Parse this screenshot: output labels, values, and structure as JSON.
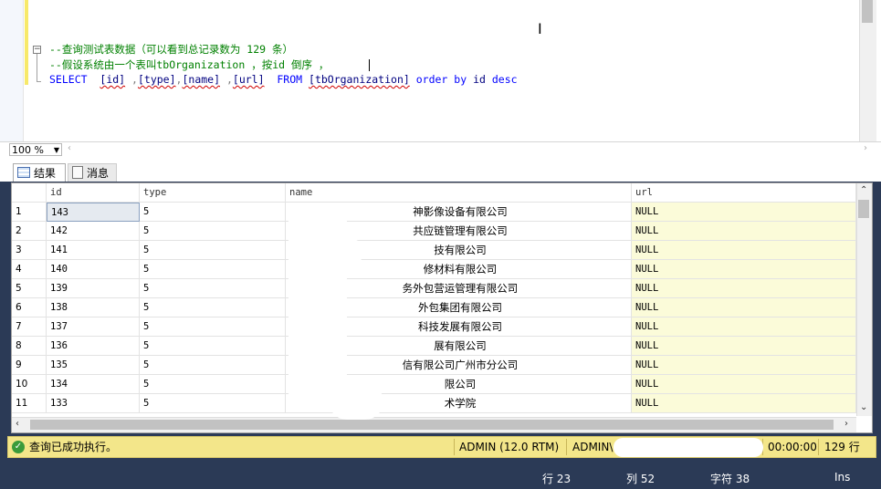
{
  "editor": {
    "line1_comment": "--查询测试表数据（可以看到总记录数为 129 条）",
    "line2_comment": "--假设系统由一个表叫tbOrganization ，按id 倒序 ， ",
    "sql": {
      "select": "SELECT",
      "col_id": "[id]",
      "col_type": "[type]",
      "col_name": "[name]",
      "col_url": "[url]",
      "from": "FROM",
      "table": "[tbOrganization]",
      "order_by": "order by",
      "order_col": "id",
      "desc": "desc"
    }
  },
  "zoom": {
    "value": "100 %"
  },
  "tabs": {
    "results": "结果",
    "messages": "消息"
  },
  "grid": {
    "columns": [
      "id",
      "type",
      "name",
      "url"
    ],
    "rows": [
      {
        "n": "1",
        "id": "143",
        "type": "5",
        "name": "神影像设备有限公司",
        "url": "NULL"
      },
      {
        "n": "2",
        "id": "142",
        "type": "5",
        "name": "共应链管理有限公司",
        "url": "NULL"
      },
      {
        "n": "3",
        "id": "141",
        "type": "5",
        "name": "技有限公司",
        "url": "NULL"
      },
      {
        "n": "4",
        "id": "140",
        "type": "5",
        "name": "修材料有限公司",
        "url": "NULL"
      },
      {
        "n": "5",
        "id": "139",
        "type": "5",
        "name": "务外包营运管理有限公司",
        "url": "NULL"
      },
      {
        "n": "6",
        "id": "138",
        "type": "5",
        "name": "外包集团有限公司",
        "url": "NULL"
      },
      {
        "n": "7",
        "id": "137",
        "type": "5",
        "name": "科技发展有限公司",
        "url": "NULL"
      },
      {
        "n": "8",
        "id": "136",
        "type": "5",
        "name": "展有限公司",
        "url": "NULL"
      },
      {
        "n": "9",
        "id": "135",
        "type": "5",
        "name": "信有限公司广州市分公司",
        "url": "NULL"
      },
      {
        "n": "10",
        "id": "134",
        "type": "5",
        "name": "限公司",
        "url": "NULL"
      },
      {
        "n": "11",
        "id": "133",
        "type": "5",
        "name": "术学院",
        "url": "NULL"
      }
    ]
  },
  "status": {
    "message": "查询已成功执行。",
    "server": "ADMIN (12.0 RTM)",
    "user": "ADMIN\\",
    "time": "00:00:00",
    "rows": "129 行"
  },
  "bottom": {
    "line": "行 23",
    "col": "列 52",
    "char": "字符 38",
    "mode": "Ins"
  },
  "colors": {
    "status_bg": "#f3e68a",
    "url_bg": "#fbfbd9",
    "window_bg": "#2b3a56"
  }
}
